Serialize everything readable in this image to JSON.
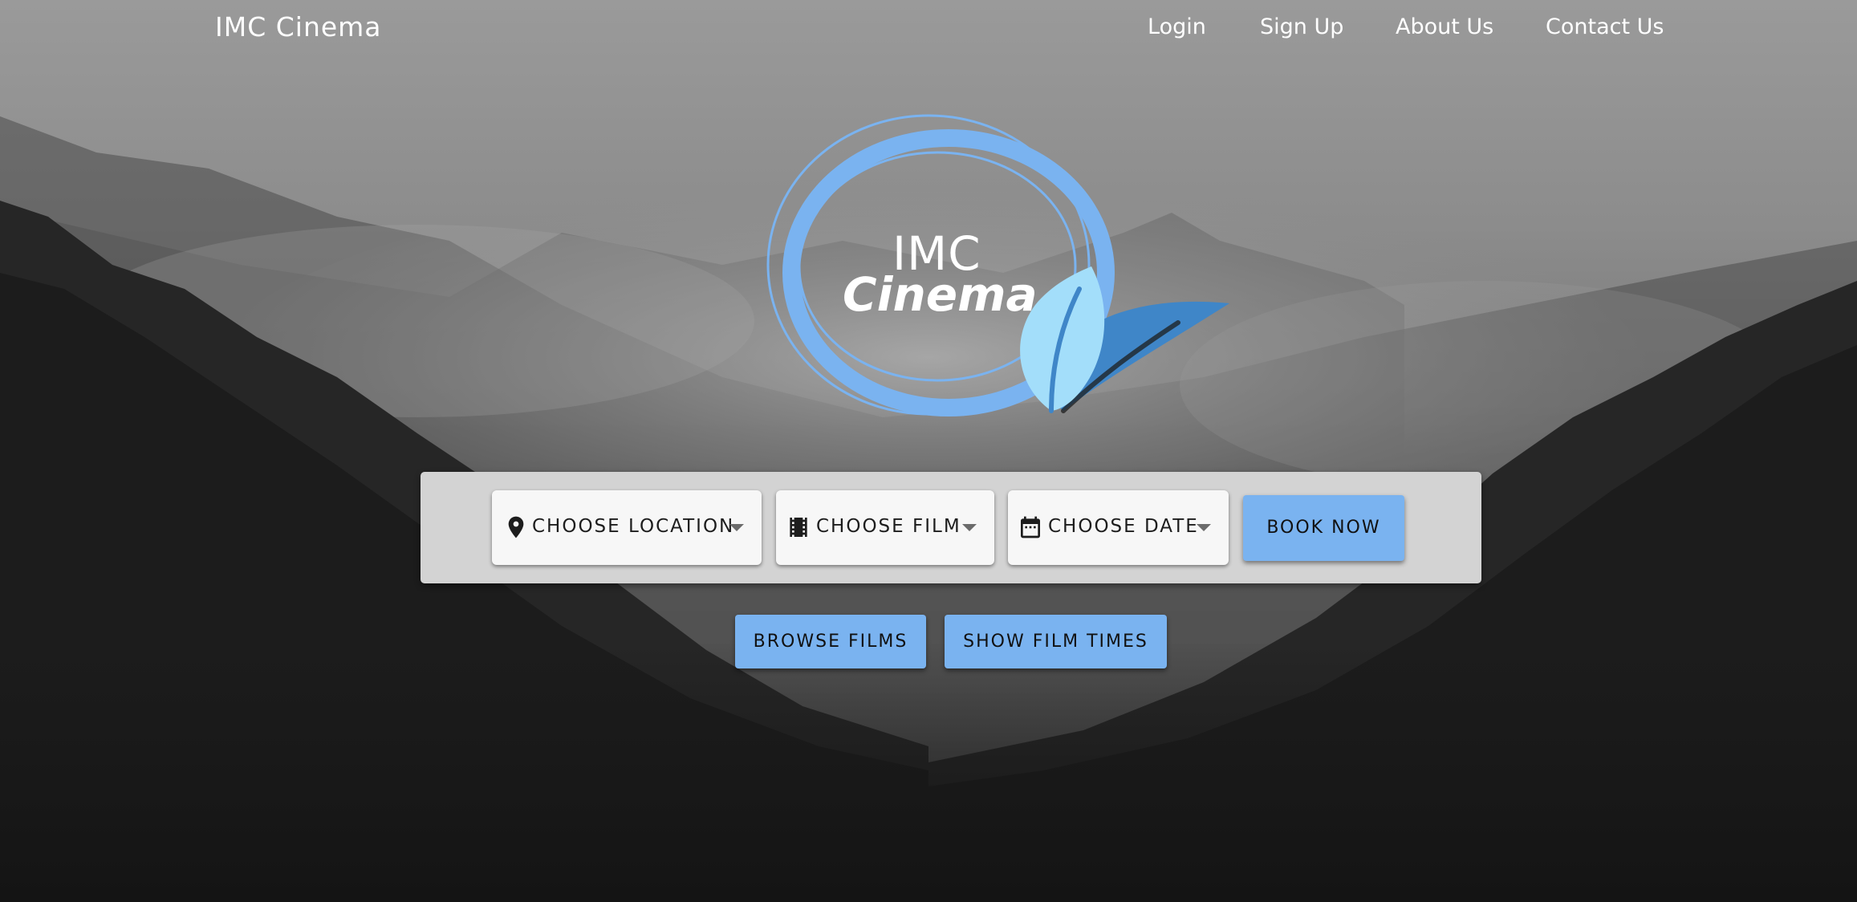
{
  "nav": {
    "brand": "IMC Cinema",
    "links": [
      "Login",
      "Sign Up",
      "About Us",
      "Contact Us"
    ]
  },
  "logo": {
    "line1": "IMC",
    "line2": "Cinema"
  },
  "booking": {
    "location_label": "CHOOSE LOCATION",
    "film_label": "CHOOSE FILM",
    "date_label": "CHOOSE DATE",
    "book_label": "BOOK NOW"
  },
  "actions": {
    "browse_label": "BROWSE FILMS",
    "times_label": "SHOW FILM TIMES"
  },
  "colors": {
    "accent": "#7ab3f0",
    "panel": "#d3d3d3",
    "select_bg": "#f7f7f7",
    "nav_text": "#ffffff"
  },
  "icons": {
    "location": "location-pin-icon",
    "film": "film-strip-icon",
    "date": "calendar-icon"
  }
}
